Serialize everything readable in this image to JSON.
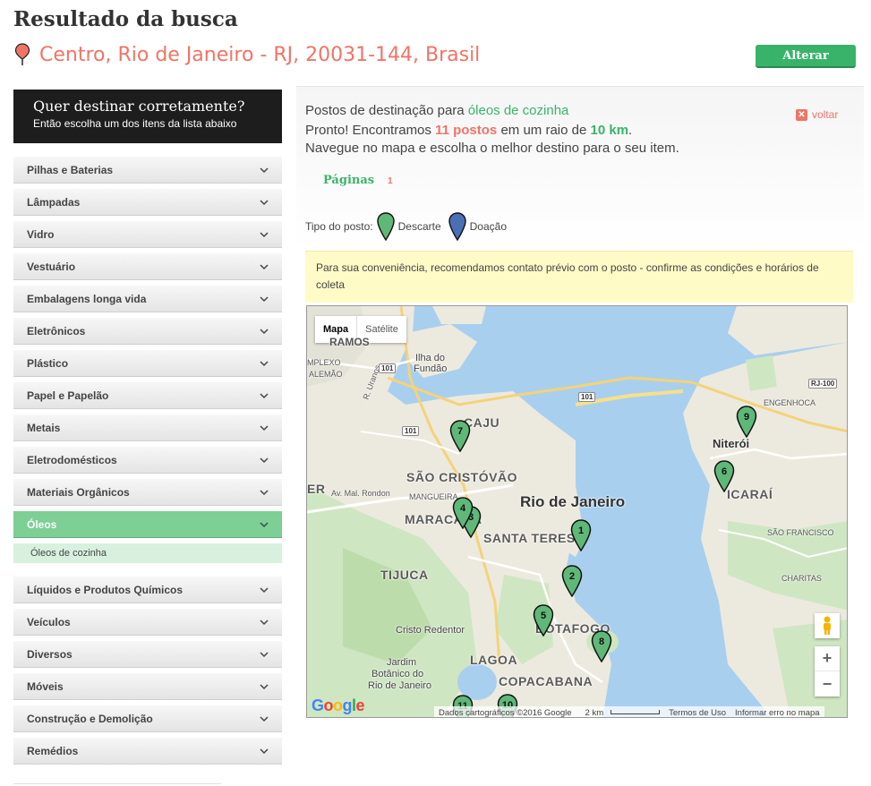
{
  "header": {
    "title": "Resultado da busca",
    "address": "Centro, Rio de Janeiro - RJ, 20031-144, Brasil",
    "alter_label": "Alterar",
    "pin_color": "#f07466"
  },
  "sidebar": {
    "heading": "Quer destinar corretamente?",
    "subheading": "Então escolha um dos itens da lista abaixo",
    "categories_top": [
      {
        "label": "Pilhas e Baterias"
      },
      {
        "label": "Lâmpadas"
      },
      {
        "label": "Vidro"
      },
      {
        "label": "Vestuário"
      },
      {
        "label": "Embalagens longa vida"
      },
      {
        "label": "Eletrônicos"
      },
      {
        "label": "Plástico"
      },
      {
        "label": "Papel e Papelão"
      },
      {
        "label": "Metais"
      },
      {
        "label": "Eletrodomésticos"
      },
      {
        "label": "Materiais Orgânicos"
      }
    ],
    "active_category": {
      "label": "Óleos",
      "sub_item": "Óleos de cozinha"
    },
    "categories_bottom": [
      {
        "label": "Líquidos e Produtos Químicos"
      },
      {
        "label": "Veículos"
      },
      {
        "label": "Diversos"
      },
      {
        "label": "Móveis"
      },
      {
        "label": "Construção e Demolição"
      },
      {
        "label": "Remédios"
      }
    ]
  },
  "results": {
    "intro": "Postos de destinação para",
    "item": "óleos de cozinha",
    "voltar": "voltar",
    "found_prefix": "Pronto! Encontramos",
    "count": "11 postos",
    "radius_prefix": "em um raio de",
    "radius": "10 km",
    "period": ".",
    "instruction": "Navegue no mapa e escolha o melhor destino para o seu item.",
    "pages_label": "Páginas",
    "page_number": "1",
    "type_label": "Tipo do posto:",
    "type_descarte": "Descarte",
    "type_doacao": "Doação",
    "descarte_color": "#5fb878",
    "doacao_color": "#4a6fb5",
    "notice": "Para sua conveniência, recomendamos contato prévio com o posto - confirme as condições e horários de coleta"
  },
  "map": {
    "type_map": "Mapa",
    "type_satellite": "Satélite",
    "zoom_in": "+",
    "zoom_out": "−",
    "google": "Google",
    "attribution": "Dados cartográficos ©2016 Google",
    "scale": "2 km",
    "terms": "Termos de Uso",
    "report": "Informar erro no mapa",
    "labels": {
      "ramos": "RAMOS",
      "complexo": "MPLEXO",
      "alemao": "ALEMÃO",
      "ilha": "Ilha do",
      "fundao": "Fundão",
      "urano": "R. Uranos",
      "caju": "CAJU",
      "sao_cristovao": "SÃO CRISTÓVÃO",
      "rio": "Rio de Janeiro",
      "maracana": "MARACANÃ",
      "mangueira": "MANGUEIRA",
      "mal_rondon": "Av. Mal. Rondon",
      "er": "ER",
      "santa_teresa": "SANTA TERES",
      "tijuca": "TIJUCA",
      "cristo": "Cristo Redentor",
      "botafogo": "BOTAFOGO",
      "lagoa": "LAGOA",
      "copacabana": "COPACABANA",
      "jardim1": "Jardim",
      "jardim2": "Botânico do",
      "jardim3": "Rio de Janeiro",
      "niteroi": "Niterói",
      "icarai": "ICARAÍ",
      "engenhoca": "ENGENHOCA",
      "sao_francisco": "SÃO FRANCISCO",
      "charitas": "CHARITAS",
      "r101a": "101",
      "r101b": "101",
      "r101c": "101",
      "rj100": "RJ-100"
    },
    "markers": [
      "1",
      "2",
      "3",
      "4",
      "5",
      "6",
      "7",
      "8",
      "9",
      "10",
      "11"
    ]
  }
}
